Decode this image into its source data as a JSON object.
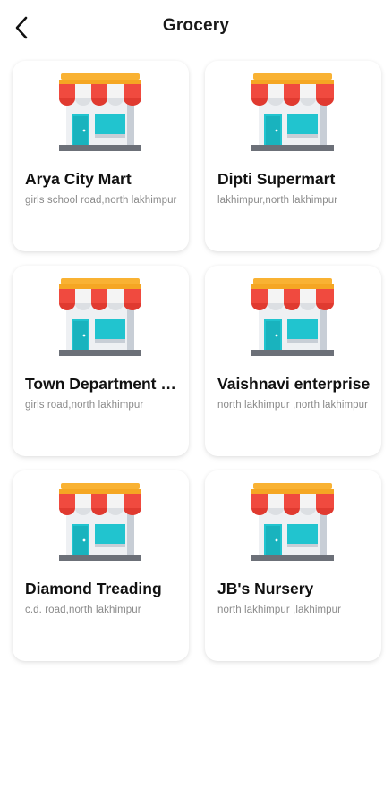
{
  "header": {
    "title": "Grocery",
    "back_icon": "chevron-left-icon"
  },
  "stores": [
    {
      "name": "Arya City Mart",
      "address": "girls school road,north lakhimpur",
      "icon": "store-icon"
    },
    {
      "name": "Dipti Supermart",
      "address": "lakhimpur,north lakhimpur",
      "icon": "store-icon"
    },
    {
      "name": "Town Department Store",
      "address": "girls road,north lakhimpur",
      "icon": "store-icon"
    },
    {
      "name": "Vaishnavi enterprise",
      "address": "north lakhimpur ,north lakhimpur",
      "icon": "store-icon"
    },
    {
      "name": "Diamond Treading",
      "address": "c.d. road,north lakhimpur",
      "icon": "store-icon"
    },
    {
      "name": "JB's Nursery",
      "address": "north lakhimpur ,lakhimpur",
      "icon": "store-icon"
    }
  ],
  "colors": {
    "awning_red": "#f04a3f",
    "awning_white": "#f4f4f4",
    "roof_yellow": "#f9b233",
    "building": "#eef0f3",
    "building_side": "#c8ced6",
    "teal": "#21c4cf",
    "base": "#6c7078"
  }
}
